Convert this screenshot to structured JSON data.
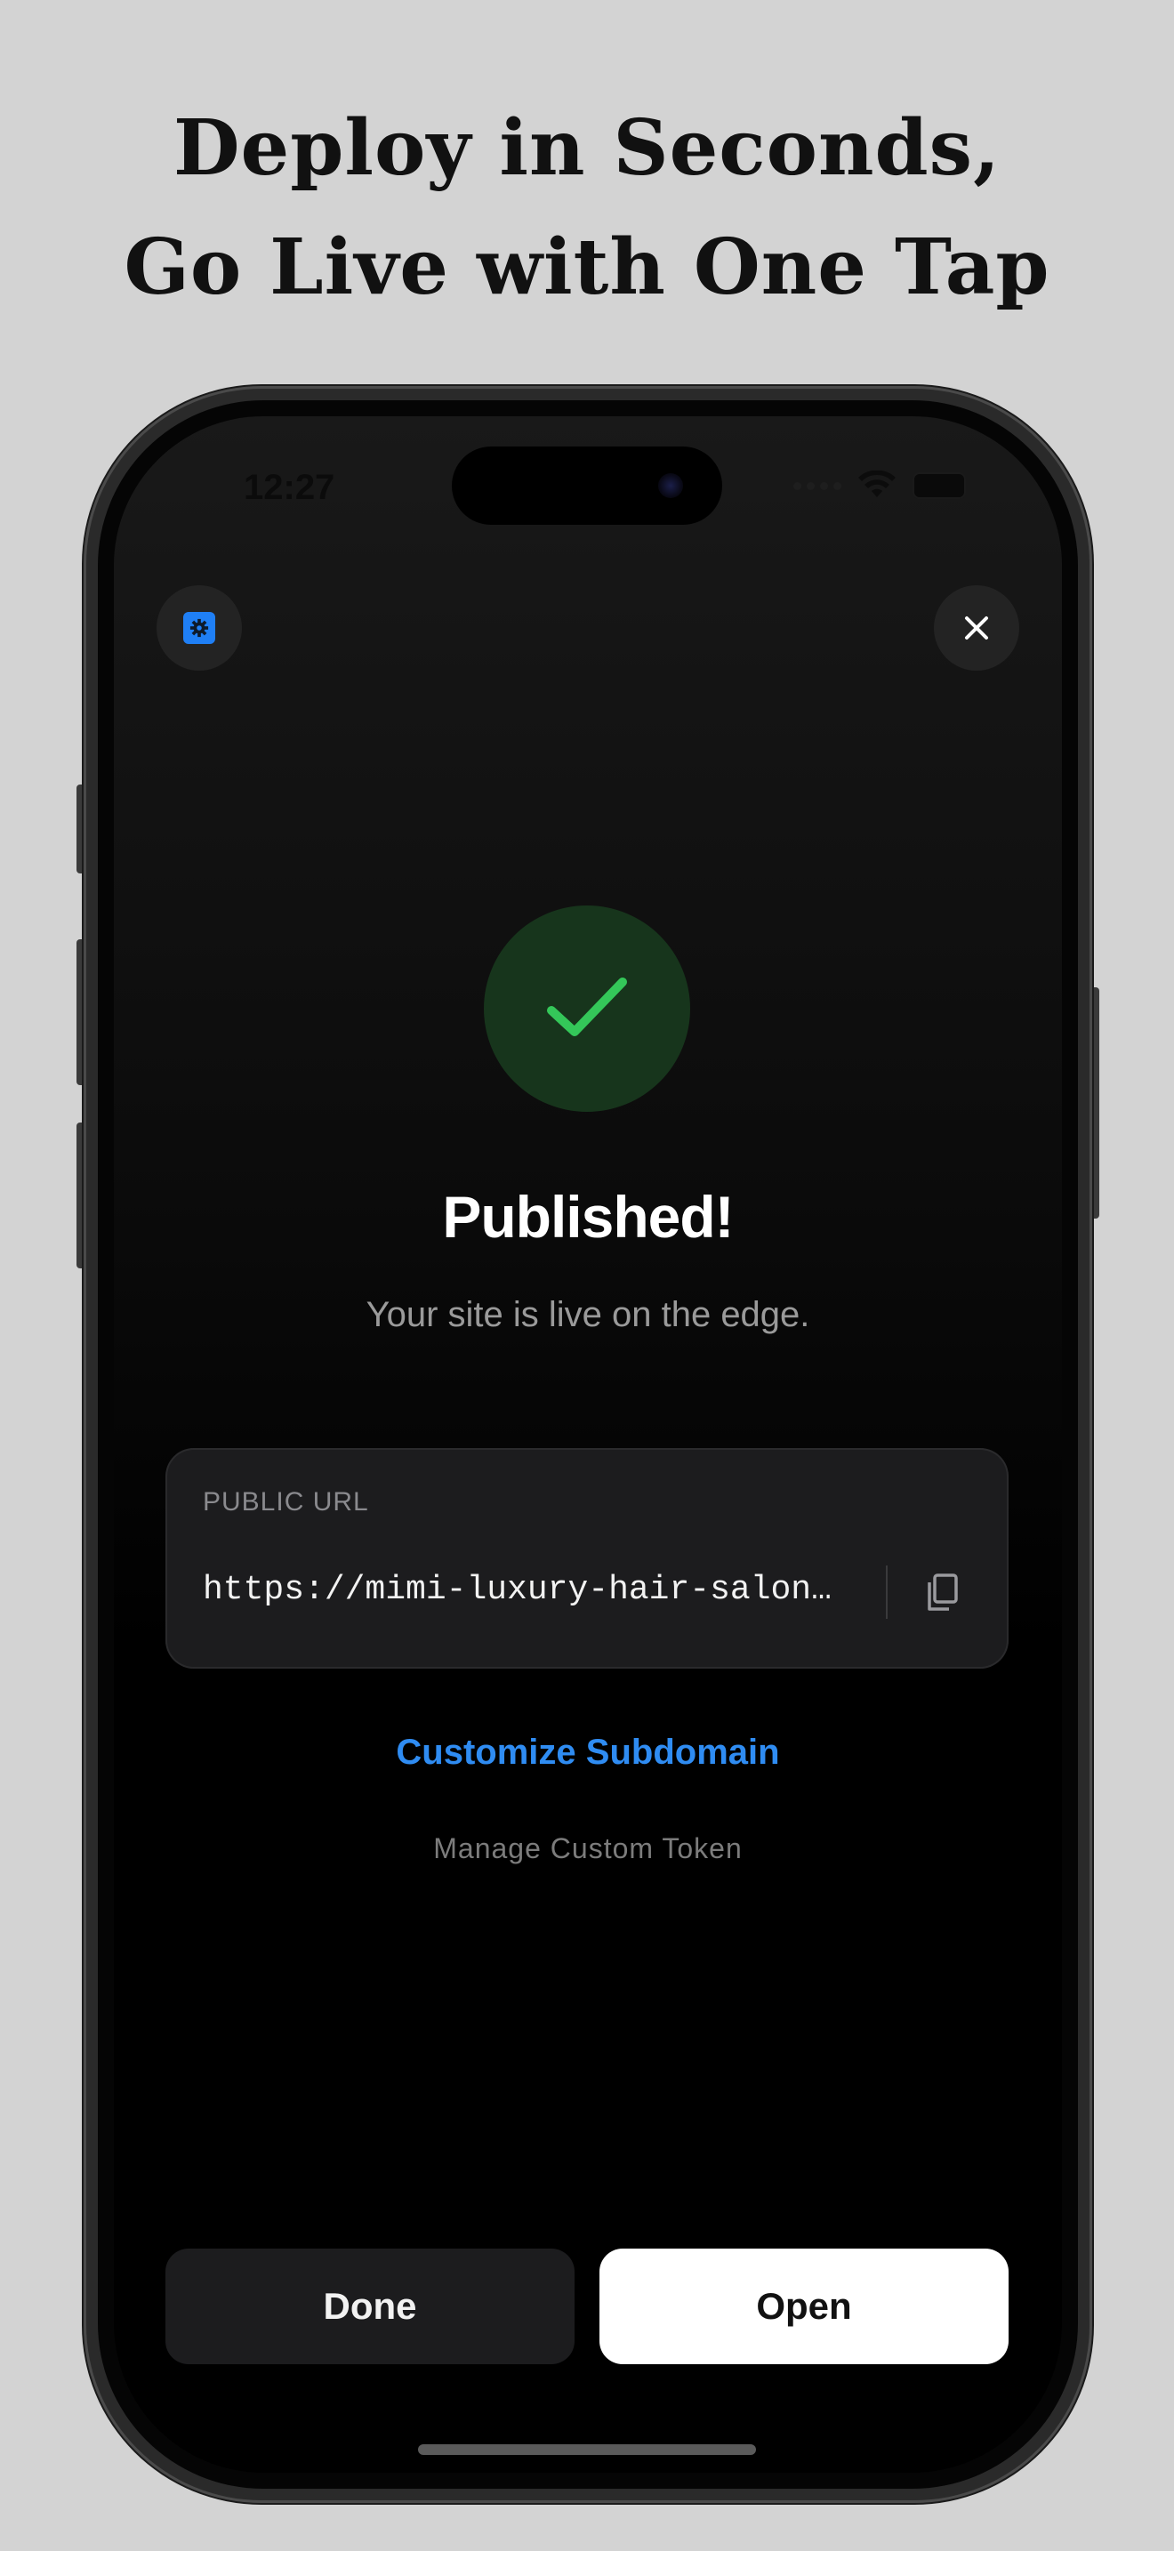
{
  "headline": {
    "line1": "Deploy in Seconds,",
    "line2": "Go Live with One Tap"
  },
  "status_bar": {
    "time": "12:27"
  },
  "icons": {
    "settings": "gear-icon",
    "close": "close-icon",
    "success": "checkmark-icon",
    "copy": "copy-icon"
  },
  "result": {
    "title": "Published!",
    "subtitle": "Your site is live on the edge."
  },
  "url_card": {
    "label": "PUBLIC URL",
    "value": "https://mimi-luxury-hair-salon…"
  },
  "links": {
    "customize_subdomain": "Customize Subdomain",
    "manage_token": "Manage Custom Token"
  },
  "buttons": {
    "done": "Done",
    "open": "Open"
  },
  "colors": {
    "accent_blue": "#2f8cf2",
    "success_green": "#34c759",
    "success_bg": "#17351c",
    "background": "#d3d3d3"
  }
}
